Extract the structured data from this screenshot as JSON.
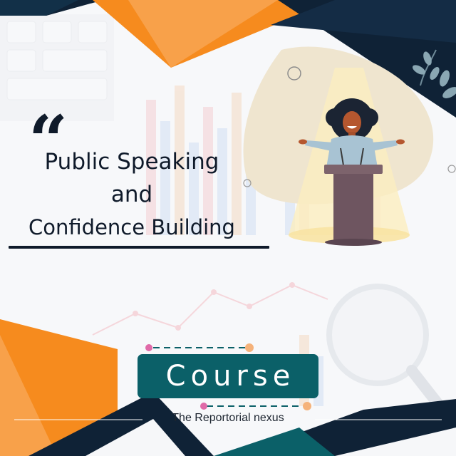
{
  "quote_glyph": "“",
  "title": {
    "line1": "Public Speaking",
    "line2": "and",
    "line3": "Confidence Building"
  },
  "badge": {
    "label": "Course"
  },
  "caption": "The Reportorial nexus",
  "colors": {
    "navy": "#0f2236",
    "orange": "#f68b1e",
    "teal": "#0b6068",
    "podium": "#6e5560",
    "beige_blob": "#efe5cf",
    "pink_dot": "#e06aa8",
    "peach_dot": "#f5b27a"
  },
  "icons": {
    "speaker": "speaker-illustration",
    "magnifier": "magnifier-icon",
    "leaves": "leaf-sprig-icon"
  }
}
